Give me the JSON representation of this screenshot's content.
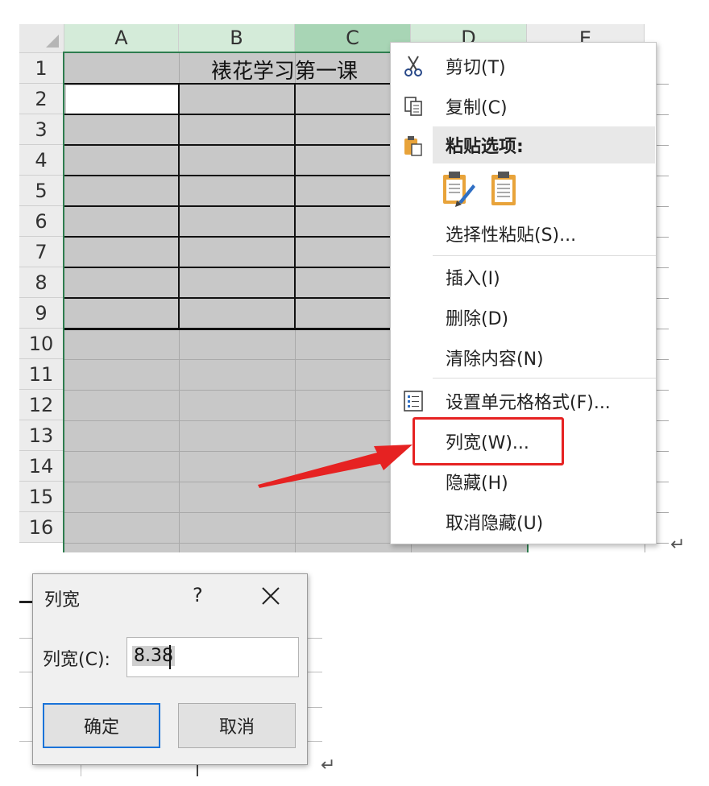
{
  "sheet": {
    "columns": [
      "A",
      "B",
      "C",
      "D",
      "E"
    ],
    "rows": [
      "1",
      "2",
      "3",
      "4",
      "5",
      "6",
      "7",
      "8",
      "9",
      "10",
      "11",
      "12",
      "13",
      "14",
      "15",
      "16"
    ],
    "title_cell": "裱花学习第一课"
  },
  "context_menu": {
    "cut": "剪切(T)",
    "copy": "复制(C)",
    "paste_options": "粘贴选项:",
    "paste_special": "选择性粘贴(S)...",
    "insert": "插入(I)",
    "delete": "删除(D)",
    "clear_contents": "清除内容(N)",
    "format_cells": "设置单元格格式(F)...",
    "column_width": "列宽(W)...",
    "hide": "隐藏(H)",
    "unhide": "取消隐藏(U)"
  },
  "dialog": {
    "title": "列宽",
    "help": "?",
    "field_label": "列宽(C):",
    "value": "8.38",
    "ok": "确定",
    "cancel": "取消"
  },
  "colors": {
    "selection": "#2e7d4f",
    "highlight": "#e62222",
    "cell_fill": "#c8c8c8"
  },
  "paragraph_mark": "↵"
}
